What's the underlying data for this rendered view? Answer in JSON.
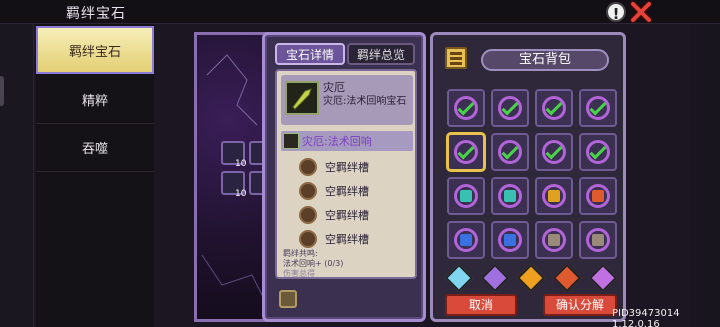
{
  "header": {
    "title": "羁绊宝石",
    "info_label": "!"
  },
  "sidebar": {
    "tabs": [
      {
        "label": "羁绊宝石",
        "active": true
      },
      {
        "label": "精粹"
      },
      {
        "label": "吞噬"
      }
    ]
  },
  "side_slots": {
    "counts": [
      "10",
      "10"
    ]
  },
  "detail": {
    "tabs": [
      "宝石详情",
      "羁绊总览"
    ],
    "gem_name": "灾厄",
    "gem_desc": "灾厄:法术回响宝石",
    "skill_label": "灾厄:法术回响",
    "slots": [
      "空羁绊槽",
      "空羁绊槽",
      "空羁绊槽",
      "空羁绊槽"
    ],
    "bonus_title": "羁绊共鸣:",
    "bonus_line1": "法术回响+ (0/3)",
    "bonus_line2": "伤害总得"
  },
  "backpack": {
    "title": "宝石背包",
    "cancel_label": "取消",
    "confirm_label": "确认分解",
    "accent_colors": {
      "cancel": "#d94a3a",
      "ring": "#b264d8",
      "check": "#4ad34a"
    },
    "cube_colors": [
      "#7fd6ee",
      "#a070e0",
      "#f0a020",
      "#e05a30",
      "#c070e0"
    ]
  },
  "build_id": "PID39473014 1.12.0.16"
}
